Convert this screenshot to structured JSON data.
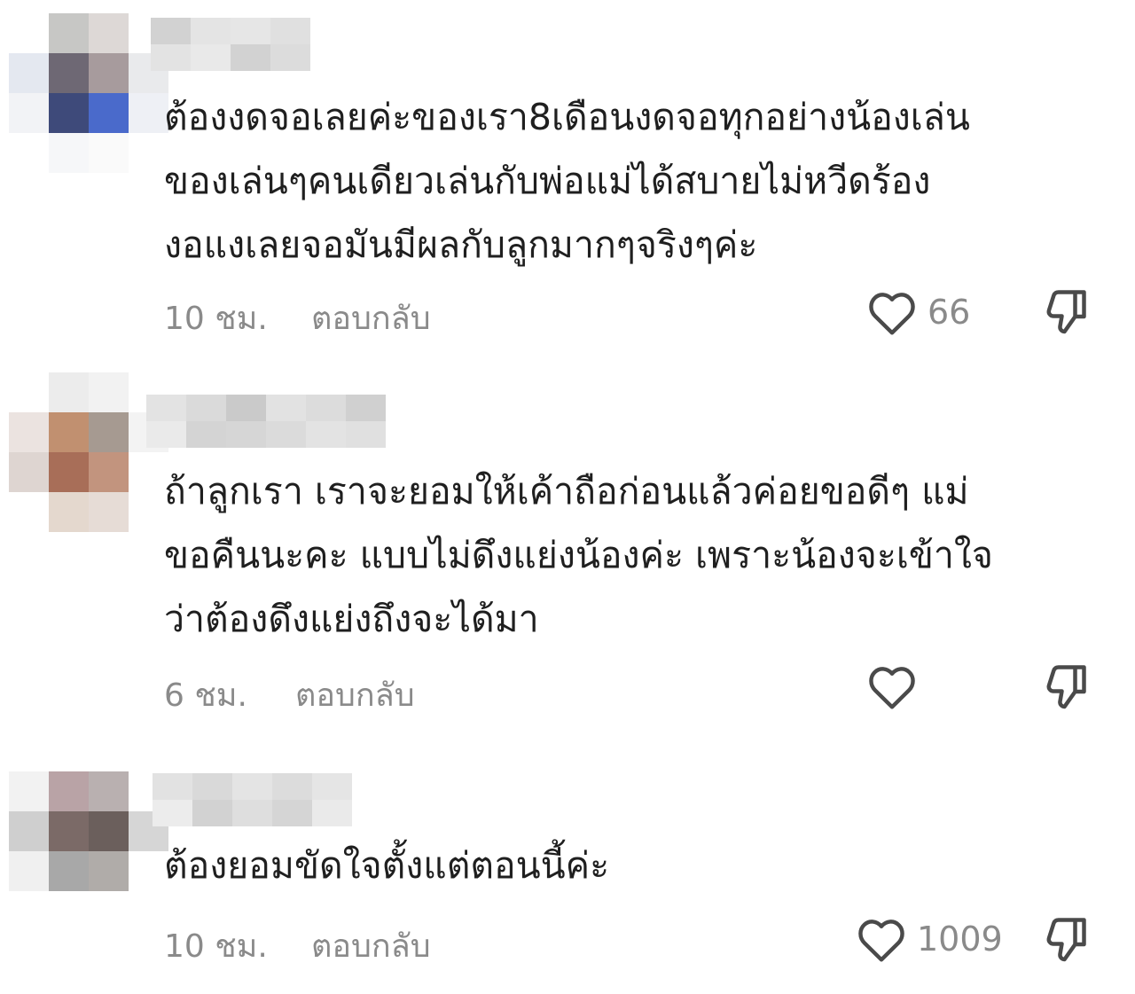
{
  "colors": {
    "text": "#1f1f1f",
    "muted": "#8a8a8a",
    "icon": "#4a4a4a"
  },
  "comments": [
    {
      "text": "ต้องงดจอเลยค่ะของเรา8เดือนงดจอทุกอย่างน้องเล่น\nของเล่นๆคนเดียวเล่นกับพ่อแม่ได้สบายไม่หวีดร้อง\nงอแงเลยจอมันมีผลกับลูกมากๆจริงๆค่ะ",
      "time": "10 ชม.",
      "reply_label": "ตอบกลับ",
      "likes": "66",
      "like_icon": "heart-outline-icon",
      "dislike_icon": "thumbs-down-outline-icon"
    },
    {
      "text": "ถ้าลูกเรา เราจะยอมให้เค้าถือก่อนแล้วค่อยขอดีๆ แม่\nขอคืนนะคะ แบบไม่ดึงแย่งน้องค่ะ เพราะน้องจะเข้าใจ\nว่าต้องดึงแย่งถึงจะได้มา",
      "time": "6 ชม.",
      "reply_label": "ตอบกลับ",
      "likes": "",
      "like_icon": "heart-outline-icon",
      "dislike_icon": "thumbs-down-outline-icon"
    },
    {
      "text": "ต้องยอมขัดใจตั้งแต่ตอนนี้ค่ะ",
      "time": "10 ชม.",
      "reply_label": "ตอบกลับ",
      "likes": "1009",
      "like_icon": "heart-outline-icon",
      "dislike_icon": "thumbs-down-outline-icon"
    }
  ]
}
